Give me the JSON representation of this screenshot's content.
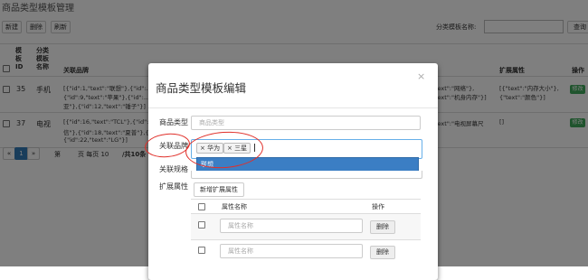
{
  "page": {
    "title": "商品类型模板管理"
  },
  "toolbar": {
    "add": "新建",
    "delete": "删除",
    "refresh": "刷新",
    "search_label": "分类模板名称:",
    "search_button": "查询"
  },
  "table": {
    "headers": {
      "id": "模板ID",
      "name": "分类模板名称",
      "brands": "关联品牌",
      "ext": "扩展属性",
      "op": "操作"
    },
    "rows": [
      {
        "id": "35",
        "name": "手机",
        "brands_l1": "[{\"id\":1,\"text\":\"联想\"},{\"id\":...",
        "brands_l2": "{\"id\":9,\"text\":\"苹果\"},{\"id\":...",
        "brands_l3": "亚\"},{\"id\":12,\"text\":\"锤子\"}]",
        "spec_l1": "\"text\":\"网络\"},",
        "spec_l2": "\"text\":\"机身内存\"}]",
        "ext_l1": "[{\"text\":\"内存大小\"},",
        "ext_l2": "{\"text\":\"颜色\"}]",
        "op": "修改"
      },
      {
        "id": "37",
        "name": "电视",
        "brands_l1": "[{\"id\":16,\"text\":\"TCL\"},{\"id\":...",
        "brands_l2": "信\"},{\"id\":18,\"text\":\"夏普\"},{\"id\":...",
        "brands_l3": "{\"id\":22,\"text\":\"LG\"}]",
        "spec_l1": "\"text\":\"电视屏幕尺",
        "ext_l1": "[]",
        "op": "修改"
      }
    ]
  },
  "pagination": {
    "prev": "«",
    "page": "1",
    "next": "»",
    "first": "第",
    "per_page": "页 每页 10",
    "total": "/共10条"
  },
  "modal": {
    "title": "商品类型模板编辑",
    "close": "×",
    "type_label": "商品类型",
    "type_placeholder": "商品类型",
    "brand_label": "关联品牌",
    "brand_tags": [
      "× 华为",
      "× 三星"
    ],
    "brand_dropdown_option": "联想",
    "spec_label": "关联规格",
    "ext_label": "扩展属性",
    "add_ext_button": "新增扩展属性",
    "ext_table": {
      "name_header": "属性名称",
      "op_header": "操作",
      "placeholder": "属性名称",
      "delete": "删除"
    }
  },
  "colors": {
    "annotation": "#e0302a",
    "dropdown": "#3b7ec4",
    "action": "#3fa85a"
  }
}
